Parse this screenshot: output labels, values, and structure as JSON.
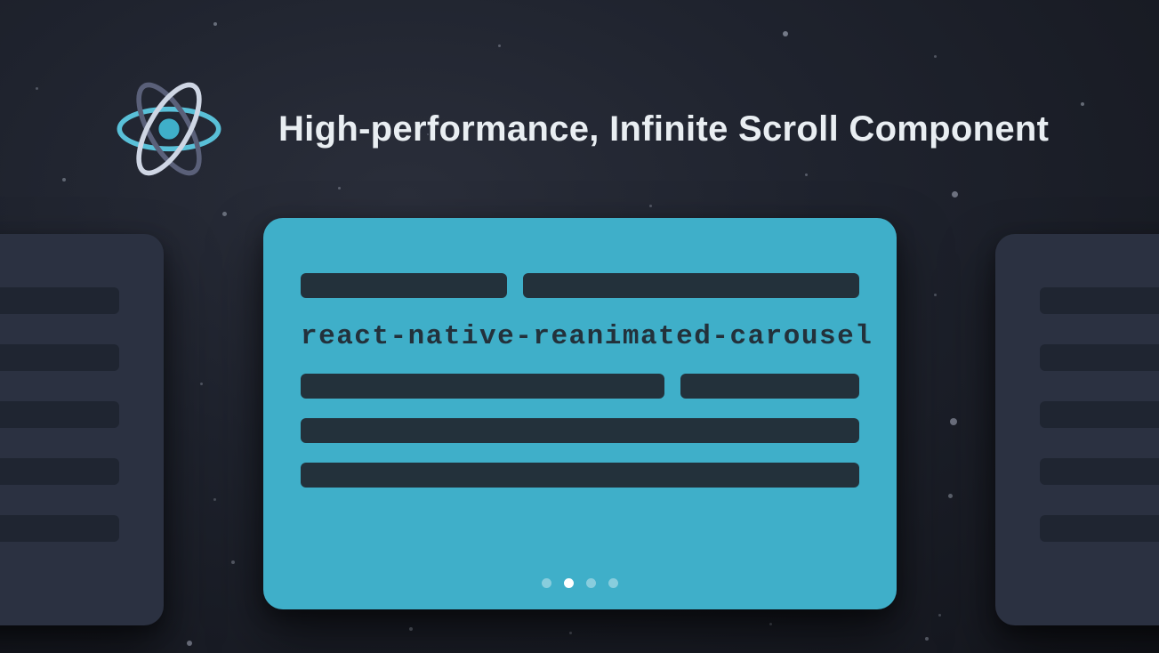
{
  "header": {
    "title": "High-performance, Infinite Scroll Component",
    "logo_name": "react-logo"
  },
  "carousel": {
    "code_text": "react-native-reanimated-carousel",
    "pager": {
      "count": 4,
      "active_index": 1
    },
    "colors": {
      "main_card_bg": "#3fafc9",
      "side_card_bg": "#2b3141",
      "bar_dark": "#23313b"
    }
  }
}
